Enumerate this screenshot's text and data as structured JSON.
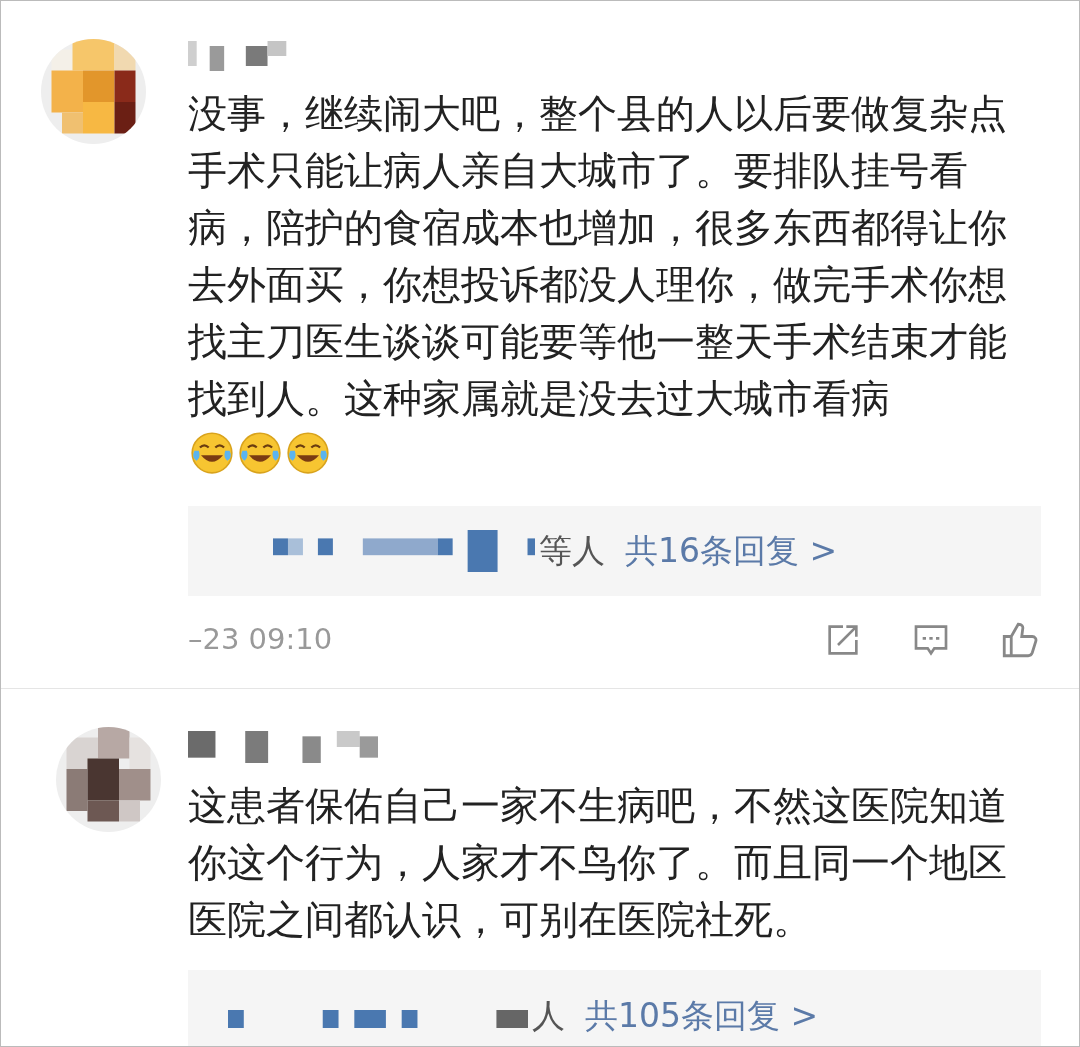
{
  "comments": [
    {
      "content": [
        {
          "kind": "text",
          "text": "没事，继续闹大吧，整个县的人以后要做复杂点手术只能让病人亲自大城市了。要排队挂号看病，陪护的食宿成本也增加，很多东西都得让你去外面买，你想投诉都没人理你，做完手术你想找主刀医生谈谈可能要等他一整天手术结束才能找到人。这种家属就是没去过大城市看病"
        },
        {
          "kind": "emoji"
        },
        {
          "kind": "emoji"
        },
        {
          "kind": "emoji"
        }
      ],
      "replies": {
        "suffix": "等人",
        "count": "共16条回复 >"
      },
      "footer": {
        "time": "–23 09:10"
      }
    },
    {
      "content": [
        {
          "kind": "text",
          "text": "这患者保佑自己一家不生病吧，不然这医院知道你这个行为，人家才不鸟你了。而且同一个地区医院之间都认识，可别在医院社死。"
        }
      ],
      "replies": {
        "suffix": "人",
        "count": "共105条回复 >"
      }
    }
  ]
}
